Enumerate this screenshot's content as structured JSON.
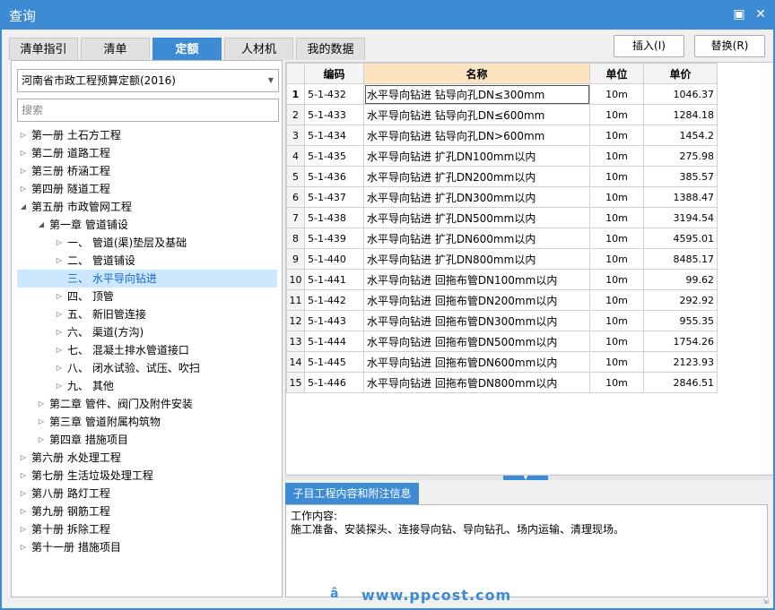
{
  "window": {
    "title": "查询",
    "maximize_icon": "maximize-icon",
    "close_icon": "close-icon"
  },
  "tabs": [
    {
      "label": "清单指引",
      "active": false
    },
    {
      "label": "清单",
      "active": false
    },
    {
      "label": "定额",
      "active": true
    },
    {
      "label": "人材机",
      "active": false
    },
    {
      "label": "我的数据",
      "active": false
    }
  ],
  "buttons": {
    "insert": "插入(I)",
    "replace": "替换(R)"
  },
  "left": {
    "library": "河南省市政工程预算定额(2016)",
    "search_placeholder": "搜索",
    "tree": [
      {
        "label": "第一册 土石方工程",
        "level": 0,
        "expanded": false
      },
      {
        "label": "第二册 道路工程",
        "level": 0,
        "expanded": false
      },
      {
        "label": "第三册 桥涵工程",
        "level": 0,
        "expanded": false
      },
      {
        "label": "第四册 隧道工程",
        "level": 0,
        "expanded": false
      },
      {
        "label": "第五册 市政管网工程",
        "level": 0,
        "expanded": true
      },
      {
        "label": "第一章 管道铺设",
        "level": 1,
        "expanded": true
      },
      {
        "label": "一、 管道(渠)垫层及基础",
        "level": 2,
        "expanded": false
      },
      {
        "label": "二、 管道铺设",
        "level": 2,
        "expanded": false
      },
      {
        "label": "三、 水平导向钻进",
        "level": 2,
        "expanded": false,
        "selected": true,
        "leaf": true
      },
      {
        "label": "四、 顶管",
        "level": 2,
        "expanded": false
      },
      {
        "label": "五、 新旧管连接",
        "level": 2,
        "expanded": false
      },
      {
        "label": "六、 渠道(方沟)",
        "level": 2,
        "expanded": false
      },
      {
        "label": "七、 混凝土排水管道接口",
        "level": 2,
        "expanded": false
      },
      {
        "label": "八、 闭水试验、试压、吹扫",
        "level": 2,
        "expanded": false
      },
      {
        "label": "九、 其他",
        "level": 2,
        "expanded": false
      },
      {
        "label": "第二章 管件、阀门及附件安装",
        "level": 1,
        "expanded": false
      },
      {
        "label": "第三章 管道附属构筑物",
        "level": 1,
        "expanded": false
      },
      {
        "label": "第四章 措施项目",
        "level": 1,
        "expanded": false
      },
      {
        "label": "第六册 水处理工程",
        "level": 0,
        "expanded": false
      },
      {
        "label": "第七册 生活垃圾处理工程",
        "level": 0,
        "expanded": false
      },
      {
        "label": "第八册 路灯工程",
        "level": 0,
        "expanded": false
      },
      {
        "label": "第九册 钢筋工程",
        "level": 0,
        "expanded": false
      },
      {
        "label": "第十册 拆除工程",
        "level": 0,
        "expanded": false
      },
      {
        "label": "第十一册 措施项目",
        "level": 0,
        "expanded": false
      }
    ]
  },
  "grid": {
    "headers": {
      "code": "编码",
      "name": "名称",
      "unit": "单位",
      "price": "单价"
    },
    "rows": [
      {
        "no": "1",
        "code": "5-1-432",
        "name": "水平导向钻进 钻导向孔DN≤300mm",
        "unit": "10m",
        "price": "1046.37"
      },
      {
        "no": "2",
        "code": "5-1-433",
        "name": "水平导向钻进 钻导向孔DN≤600mm",
        "unit": "10m",
        "price": "1284.18"
      },
      {
        "no": "3",
        "code": "5-1-434",
        "name": "水平导向钻进 钻导向孔DN>600mm",
        "unit": "10m",
        "price": "1454.2"
      },
      {
        "no": "4",
        "code": "5-1-435",
        "name": "水平导向钻进 扩孔DN100mm以内",
        "unit": "10m",
        "price": "275.98"
      },
      {
        "no": "5",
        "code": "5-1-436",
        "name": "水平导向钻进 扩孔DN200mm以内",
        "unit": "10m",
        "price": "385.57"
      },
      {
        "no": "6",
        "code": "5-1-437",
        "name": "水平导向钻进 扩孔DN300mm以内",
        "unit": "10m",
        "price": "1388.47"
      },
      {
        "no": "7",
        "code": "5-1-438",
        "name": "水平导向钻进 扩孔DN500mm以内",
        "unit": "10m",
        "price": "3194.54"
      },
      {
        "no": "8",
        "code": "5-1-439",
        "name": "水平导向钻进 扩孔DN600mm以内",
        "unit": "10m",
        "price": "4595.01"
      },
      {
        "no": "9",
        "code": "5-1-440",
        "name": "水平导向钻进 扩孔DN800mm以内",
        "unit": "10m",
        "price": "8485.17"
      },
      {
        "no": "10",
        "code": "5-1-441",
        "name": "水平导向钻进 回拖布管DN100mm以内",
        "unit": "10m",
        "price": "99.62"
      },
      {
        "no": "11",
        "code": "5-1-442",
        "name": "水平导向钻进 回拖布管DN200mm以内",
        "unit": "10m",
        "price": "292.92"
      },
      {
        "no": "12",
        "code": "5-1-443",
        "name": "水平导向钻进 回拖布管DN300mm以内",
        "unit": "10m",
        "price": "955.35"
      },
      {
        "no": "13",
        "code": "5-1-444",
        "name": "水平导向钻进 回拖布管DN500mm以内",
        "unit": "10m",
        "price": "1754.26"
      },
      {
        "no": "14",
        "code": "5-1-445",
        "name": "水平导向钻进 回拖布管DN600mm以内",
        "unit": "10m",
        "price": "2123.93"
      },
      {
        "no": "15",
        "code": "5-1-446",
        "name": "水平导向钻进 回拖布管DN800mm以内",
        "unit": "10m",
        "price": "2846.51"
      }
    ]
  },
  "info": {
    "tab_label": "子目工程内容和附注信息",
    "content_title": "工作内容:",
    "content_text": "施工准备、安装探头、连接导向钻、导向钻孔、场内运输、清理现场。"
  },
  "watermark": {
    "text": "www.ppcost.com",
    "icon_glyph": "â"
  }
}
